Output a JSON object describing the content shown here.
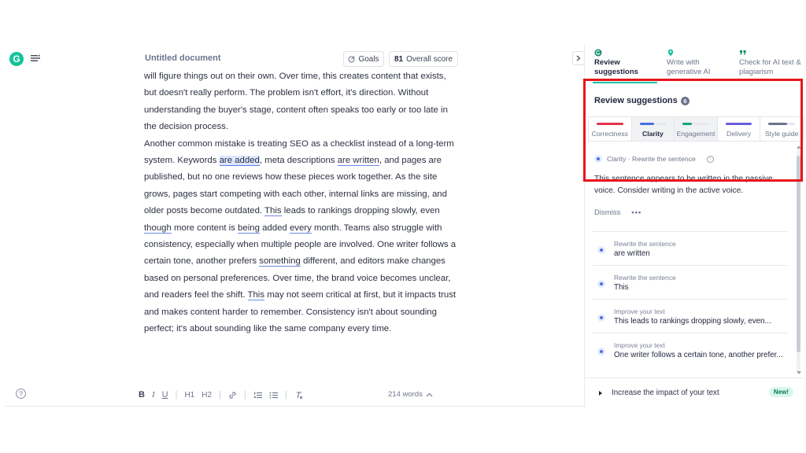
{
  "logo": "G",
  "document": {
    "title": "Untitled document",
    "goals_label": "Goals",
    "score_value": "81",
    "score_label": "Overall score"
  },
  "editor": {
    "p1": {
      "a": "will figure things out on their own. Over time, this creates content that exists, but doesn't really perform. The problem isn't effort, it's direction. Without understanding the buyer's stage, content often speaks too early or too late in the decision process."
    },
    "p2": {
      "a": "Another common mistake is treating SEO as a checklist instead of a long-term system. Keywords ",
      "b": "are added",
      "c": ", meta descriptions ",
      "d": "are written",
      "e": ", and pages are published, but no one reviews how these pieces work together. As the site grows, pages start competing with each other, internal links are missing, and older posts become outdated. ",
      "f": "This",
      "g": " leads to rankings dropping slowly, even ",
      "h": "though",
      "i": " more content is ",
      "j": "being",
      "k": " added ",
      "l": "every",
      "m": " month. Teams also struggle with consistency, especially when multiple people are involved. One writer follows a certain tone, another prefers ",
      "n": "something",
      "o": " different, and editors make changes based on personal preferences. Over time, the brand voice becomes unclear, and readers feel the shift. ",
      "p": "This",
      "q": " may not seem critical at first, but it impacts trust and makes content harder to remember. Consistency isn't about sounding perfect; it's about sounding like the same company every time."
    }
  },
  "toolbar": {
    "help": "?",
    "bold": "B",
    "italic": "I",
    "underline": "U",
    "h1": "H1",
    "h2": "H2",
    "word_count": "214 words"
  },
  "panel": {
    "tabs": [
      {
        "label": "Review suggestions",
        "icon": "grammarly-g-icon",
        "color": "#15c39a"
      },
      {
        "label": "Write with generative AI",
        "icon": "location-pin-icon",
        "color": "#15c39a"
      },
      {
        "label": "Check for AI text & plagiarism",
        "icon": "quote-icon",
        "color": "#15c39a"
      }
    ],
    "section_title": "Review suggestions",
    "badge": "6",
    "categories": [
      {
        "label": "Correctness",
        "color": "#e5334b",
        "fill": 1.0
      },
      {
        "label": "Clarity",
        "color": "#4a6ee0",
        "fill": 0.55
      },
      {
        "label": "Engagement",
        "color": "#15a382",
        "fill": 0.35
      },
      {
        "label": "Delivery",
        "color": "#6a5ce0",
        "fill": 1.0
      },
      {
        "label": "Style guide",
        "color": "#6d758d",
        "fill": 0.7
      }
    ],
    "active_card": {
      "header": "Clarity · Rewrite the sentence",
      "body": "This sentence appears to be written in the passive voice. Consider writing in the active voice.",
      "dismiss": "Dismiss",
      "more": "•••"
    },
    "suggestions": [
      {
        "title": "Rewrite the sentence",
        "text": "are written"
      },
      {
        "title": "Rewrite the sentence",
        "text": "This"
      },
      {
        "title": "Improve your text",
        "text": "This leads to rankings dropping slowly, even..."
      },
      {
        "title": "Improve your text",
        "text": "One writer follows a certain tone, another prefer..."
      }
    ],
    "impact_text": "Increase the impact of your text",
    "new_badge": "New!"
  }
}
